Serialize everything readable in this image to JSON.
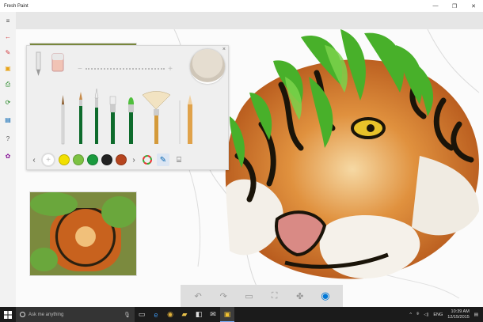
{
  "window": {
    "title": "Fresh Paint",
    "controls": {
      "minimize": "—",
      "restore": "❐",
      "close": "✕"
    }
  },
  "sidebar": {
    "items": [
      {
        "icon": "hamburger-menu-icon",
        "glyph": "≡",
        "color": "#444444"
      },
      {
        "icon": "back-arrow-icon",
        "glyph": "←",
        "color": "#d13438"
      },
      {
        "icon": "new-painting-icon",
        "glyph": "✎",
        "color": "#d13438"
      },
      {
        "icon": "import-icon",
        "glyph": "▣",
        "color": "#e8a317"
      },
      {
        "icon": "print-icon",
        "glyph": "⎙",
        "color": "#107c10"
      },
      {
        "icon": "share-icon",
        "glyph": "⟳",
        "color": "#107c10"
      },
      {
        "icon": "save-icon",
        "glyph": "▤",
        "color": "#0063b1"
      },
      {
        "icon": "help-icon",
        "glyph": "?",
        "color": "#555555"
      },
      {
        "icon": "settings-icon",
        "glyph": "✿",
        "color": "#881798"
      }
    ]
  },
  "palette": {
    "close": "×",
    "slider": {
      "minus": "−",
      "plus": "+"
    },
    "tools": [
      {
        "icon": "pencil-tool-icon",
        "kind": "pencil"
      },
      {
        "icon": "eraser-tool-icon",
        "kind": "eraser"
      },
      {
        "icon": "thin-brush-icon",
        "kind": "brush"
      },
      {
        "icon": "round-brush-icon",
        "kind": "brush"
      },
      {
        "icon": "detail-brush-icon",
        "kind": "brush"
      },
      {
        "icon": "flat-brush-icon",
        "kind": "brush"
      },
      {
        "icon": "filbert-brush-icon",
        "kind": "brush"
      },
      {
        "icon": "fan-brush-icon",
        "kind": "brush"
      },
      {
        "icon": "colored-pencil-icon",
        "kind": "pencil"
      }
    ],
    "swatches": [
      "#ffffff",
      "#f2e000",
      "#7cc242",
      "#1a9a3e",
      "#222222",
      "#b6451f"
    ],
    "swatch_add": "+",
    "colors_hex": {
      "accent": "#0078d7"
    }
  },
  "bottombar": {
    "buttons": [
      {
        "icon": "undo-icon",
        "glyph": "↶"
      },
      {
        "icon": "redo-icon",
        "glyph": "↷"
      },
      {
        "icon": "layers-icon",
        "glyph": "▭"
      },
      {
        "icon": "crop-icon",
        "glyph": "⛶"
      },
      {
        "icon": "fan-icon",
        "glyph": "✤"
      },
      {
        "icon": "blend-icon",
        "glyph": "◉"
      }
    ]
  },
  "taskbar": {
    "search_placeholder": "Ask me anything",
    "time": "10:39 AM",
    "date": "12/15/2015",
    "lang": "ENG"
  }
}
